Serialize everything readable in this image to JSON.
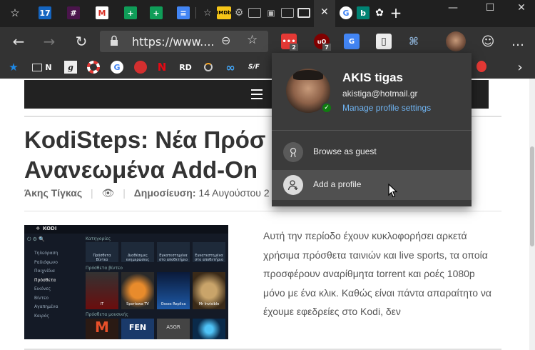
{
  "tabbar": {
    "tabs": [
      {
        "icon": "favorites-star-icon"
      },
      {
        "icon": "calendar-17-icon",
        "text": "17"
      },
      {
        "icon": "slack-icon"
      },
      {
        "icon": "gmail-icon"
      },
      {
        "icon": "sheets-icon"
      },
      {
        "icon": "sheets-icon"
      },
      {
        "icon": "docs-icon"
      },
      {
        "icon": "star-page-icon"
      },
      {
        "icon": "imdb-icon",
        "text": "IMDb"
      },
      {
        "icon": "settings-gear-icon"
      },
      {
        "icon": "reader-icon"
      },
      {
        "icon": "shopping-icon"
      },
      {
        "icon": "reader-icon"
      },
      {
        "icon": "reader-icon"
      },
      {
        "icon": "active-tab-close-icon"
      },
      {
        "icon": "google-icon",
        "text": "G"
      },
      {
        "icon": "bing-icon",
        "text": "b"
      },
      {
        "icon": "puzzle-icon"
      }
    ],
    "new_tab": "+",
    "window_controls": {
      "minimize": "—",
      "maximize": "☐",
      "close": "✕"
    }
  },
  "toolbar": {
    "back": "←",
    "forward": "→",
    "refresh": "↻",
    "url": "https://www....",
    "zoom": "⊖",
    "favorite": "☆",
    "extensions": [
      {
        "name": "extension-red-badge",
        "badge": "2"
      },
      {
        "name": "ublock-extension",
        "text": "uO",
        "badge": "7"
      },
      {
        "name": "translate-extension",
        "text": "G"
      },
      {
        "name": "notes-extension"
      },
      {
        "name": "share-extension"
      }
    ],
    "emoji": "☺",
    "more": "…"
  },
  "bookmarks": {
    "items": [
      {
        "name": "star",
        "text": "★"
      },
      {
        "name": "folder",
        "text": "N"
      },
      {
        "name": "g-script",
        "text": "g"
      },
      {
        "name": "lifebuoy",
        "text": ""
      },
      {
        "name": "google",
        "text": "G"
      },
      {
        "name": "redbull",
        "text": ""
      },
      {
        "name": "netflix",
        "text": "N"
      },
      {
        "name": "rd",
        "text": "RD"
      },
      {
        "name": "circle",
        "text": ""
      },
      {
        "name": "infinity",
        "text": "∞"
      },
      {
        "name": "sf",
        "text": "S/F"
      }
    ],
    "more": "›"
  },
  "page": {
    "title_line1": "KodiSteps: Νέα Πρόσ",
    "title_line2": "Ανανεωμένα Add-On",
    "author": "Άκης Τίγκας",
    "published_label": "Δημοσίευση:",
    "published_date": "14 Αυγούστου 2",
    "body": "Αυτή την περίοδο έχουν κυκλοφορήσει αρκετά χρήσιμα πρόσθετα ταινιών και live sports, τα οποία προσφέρουν αναρίθμητα torrent και ροές 1080p μόνο με ένα κλικ. Καθώς είναι πάντα απαραίτητο να έχουμε εφεδρείες στο Kodi, δεν",
    "thumb_title": "KODI",
    "thumb_sidebar": [
      "Τηλεόραση",
      "Ραδιόφωνο",
      "Παιχνίδια",
      "Πρόσθετα",
      "Εικόνες",
      "Βίντεο",
      "Αγαπημένα",
      "Καιρός"
    ],
    "thumb_section": "Κατηγορίες",
    "thumb_categories": [
      "Πρόσθετα Βίντεο",
      "Διαθέσιμες ενημερώσεις",
      "Εγκατεστημένα στο αποθετήριο",
      "Εγκατεστημένα στο αποθετήριο"
    ],
    "thumb_row2_label": "Πρόσθετα βίντεο",
    "thumb_addons": [
      "IT",
      "Sportowa TV",
      "Ossex Replica",
      "Mr Invisible"
    ],
    "thumb_row3_label": "Πρόσθετα μουσικής",
    "thumb_row3": [
      "M",
      "FEN",
      "ASGR",
      ""
    ]
  },
  "profile_menu": {
    "name": "AKIS tigas",
    "email": "akistiga@hotmail.gr",
    "manage": "Manage profile settings",
    "browse_guest": "Browse as guest",
    "add_profile": "Add a profile"
  }
}
